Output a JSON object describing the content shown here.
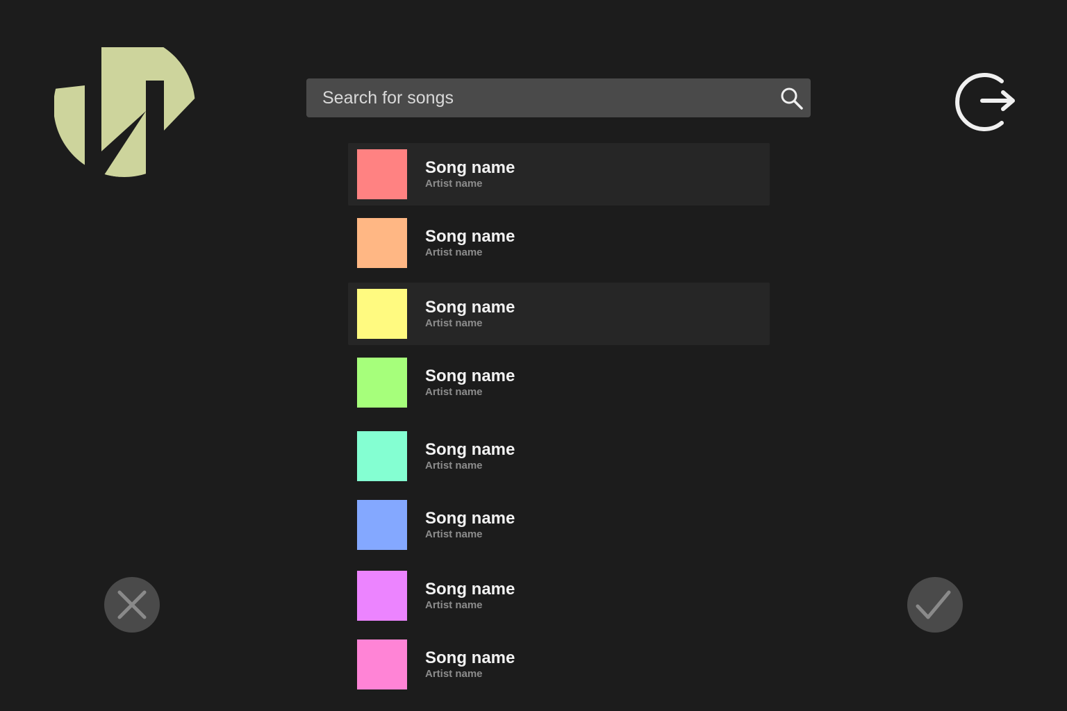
{
  "app": {
    "brand_color": "#cdd49c",
    "background": "#1c1c1c"
  },
  "header": {
    "logo_icon": "app-logo-icon",
    "logout_icon": "logout-icon"
  },
  "search": {
    "placeholder": "Search for songs",
    "value": "",
    "icon": "search-icon"
  },
  "songs": [
    {
      "title": "Song name",
      "artist": "Artist name",
      "color": "#ff8282",
      "highlighted": true
    },
    {
      "title": "Song name",
      "artist": "Artist name",
      "color": "#ffb784",
      "highlighted": false
    },
    {
      "title": "Song name",
      "artist": "Artist name",
      "color": "#fffa80",
      "highlighted": true
    },
    {
      "title": "Song name",
      "artist": "Artist name",
      "color": "#a6ff7b",
      "highlighted": false
    },
    {
      "title": "Song name",
      "artist": "Artist name",
      "color": "#84ffd2",
      "highlighted": false
    },
    {
      "title": "Song name",
      "artist": "Artist name",
      "color": "#84a8ff",
      "highlighted": false
    },
    {
      "title": "Song name",
      "artist": "Artist name",
      "color": "#ec84ff",
      "highlighted": false
    },
    {
      "title": "Song name",
      "artist": "Artist name",
      "color": "#ff84d6",
      "highlighted": false
    }
  ],
  "actions": {
    "cancel_icon": "close-icon",
    "confirm_icon": "checkmark-icon"
  }
}
